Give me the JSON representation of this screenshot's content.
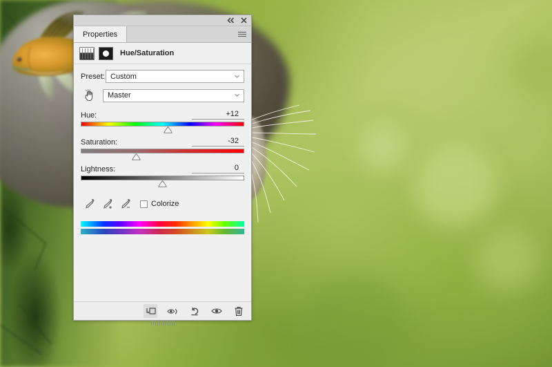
{
  "panel": {
    "titlebar": {
      "collapse_icon": "double-chevron-left-icon",
      "close_icon": "close-icon"
    },
    "tabs": [
      {
        "label": "Properties",
        "active": true
      }
    ],
    "menu_icon": "panel-menu-icon",
    "adjustment": {
      "icon": "hue-saturation-adjustment-icon",
      "mask_icon": "layer-mask-thumbnail-icon",
      "title": "Hue/Saturation"
    },
    "preset": {
      "label": "Preset:",
      "value": "Custom",
      "placeholder": "Custom",
      "chevron_icon": "chevron-down-icon"
    },
    "channel": {
      "tool_icon": "on-image-adjustment-hand-icon",
      "value": "Master",
      "placeholder": "Master",
      "chevron_icon": "chevron-down-icon"
    },
    "sliders": [
      {
        "name": "Hue:",
        "value": "+12",
        "numeric": 12,
        "min": -180,
        "max": 180,
        "percent": 53.3,
        "track": "hue-spectrum"
      },
      {
        "name": "Saturation:",
        "value": "-32",
        "numeric": -32,
        "min": -100,
        "max": 100,
        "percent": 34,
        "track": "gray-to-red"
      },
      {
        "name": "Lightness:",
        "value": "0",
        "numeric": 0,
        "min": -100,
        "max": 100,
        "percent": 50,
        "track": "black-to-white"
      }
    ],
    "droppers": [
      {
        "name": "eyedropper-sample-icon",
        "label": ""
      },
      {
        "name": "eyedropper-add-icon",
        "label": "+"
      },
      {
        "name": "eyedropper-subtract-icon",
        "label": "-"
      }
    ],
    "colorize": {
      "label": "Colorize",
      "checked": false
    },
    "spectrum_bars": {
      "top": "full-saturation-spectrum",
      "bottom": "adjusted-spectrum"
    },
    "footer_buttons": [
      {
        "name": "clip-to-layer-button",
        "icon": "clip-to-layer-icon",
        "active": true
      },
      {
        "name": "toggle-mask-view-button",
        "icon": "eye-with-arrow-icon",
        "active": false
      },
      {
        "name": "reset-button",
        "icon": "reset-arrow-icon",
        "active": false
      },
      {
        "name": "toggle-visibility-button",
        "icon": "eye-icon",
        "active": false
      },
      {
        "name": "delete-layer-button",
        "icon": "trash-icon",
        "active": false
      }
    ],
    "resize_grip": "panel-resize-grip"
  },
  "background": {
    "description": "Blurred green bokeh photograph with a goldfish upper right and a furry gray animal lower left",
    "subjects": [
      "goldfish",
      "furry-animal",
      "foliage"
    ]
  },
  "colors": {
    "panel_bg": "#f0f0f0",
    "panel_chrome": "#d6d6d6",
    "panel_border": "#9d9d9d",
    "text": "#262626",
    "field_bg": "#ffffff",
    "field_border": "#a8a8a8",
    "green_bg": "#8fae3e"
  }
}
